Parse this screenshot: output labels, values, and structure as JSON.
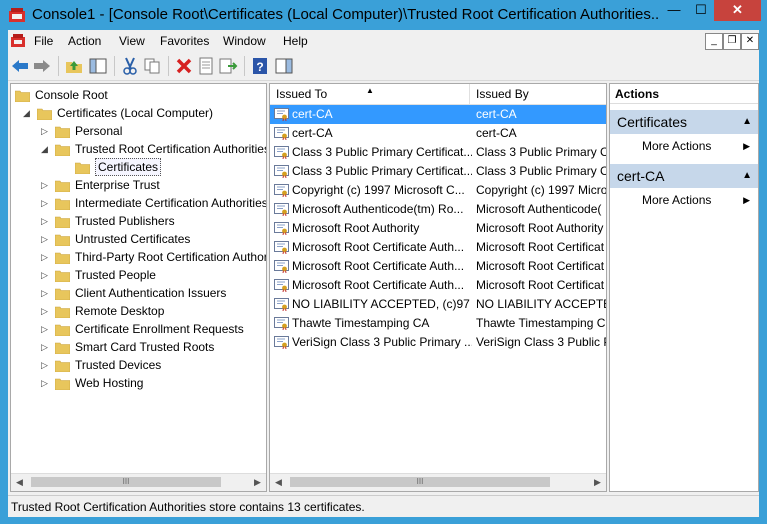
{
  "window": {
    "title": "Console1 - [Console Root\\Certificates (Local Computer)\\Trusted Root Certification Authorities..."
  },
  "titlebar_buttons": {
    "minimize": "—",
    "maximize": "☐",
    "close": "✕"
  },
  "menubar": {
    "items": [
      "File",
      "Action",
      "View",
      "Favorites",
      "Window",
      "Help"
    ],
    "mdi": {
      "minimize": "_",
      "restore": "❐",
      "close": "✕"
    }
  },
  "tree": {
    "items": [
      {
        "label": "Console Root",
        "level": 0,
        "expander": ""
      },
      {
        "label": "Certificates (Local Computer)",
        "level": 1,
        "expander": "◢"
      },
      {
        "label": "Personal",
        "level": 2,
        "expander": "▷"
      },
      {
        "label": "Trusted Root Certification Authorities",
        "level": 2,
        "expander": "◢"
      },
      {
        "label": "Certificates",
        "level": 3,
        "expander": "",
        "selected": true
      },
      {
        "label": "Enterprise Trust",
        "level": 2,
        "expander": "▷"
      },
      {
        "label": "Intermediate Certification Authorities",
        "level": 2,
        "expander": "▷"
      },
      {
        "label": "Trusted Publishers",
        "level": 2,
        "expander": "▷"
      },
      {
        "label": "Untrusted Certificates",
        "level": 2,
        "expander": "▷"
      },
      {
        "label": "Third-Party Root Certification Authorities",
        "level": 2,
        "expander": "▷"
      },
      {
        "label": "Trusted People",
        "level": 2,
        "expander": "▷"
      },
      {
        "label": "Client Authentication Issuers",
        "level": 2,
        "expander": "▷"
      },
      {
        "label": "Remote Desktop",
        "level": 2,
        "expander": "▷"
      },
      {
        "label": "Certificate Enrollment Requests",
        "level": 2,
        "expander": "▷"
      },
      {
        "label": "Smart Card Trusted Roots",
        "level": 2,
        "expander": "▷"
      },
      {
        "label": "Trusted Devices",
        "level": 2,
        "expander": "▷"
      },
      {
        "label": "Web Hosting",
        "level": 2,
        "expander": "▷"
      }
    ]
  },
  "list": {
    "columns": [
      "Issued To",
      "Issued By"
    ],
    "sort_indicator": "▲",
    "rows": [
      {
        "issued_to": "cert-CA",
        "issued_by": "cert-CA",
        "selected": true
      },
      {
        "issued_to": "cert-CA",
        "issued_by": "cert-CA"
      },
      {
        "issued_to": "Class 3 Public Primary Certificat...",
        "issued_by": "Class 3 Public Primary C"
      },
      {
        "issued_to": "Class 3 Public Primary Certificat...",
        "issued_by": "Class 3 Public Primary C"
      },
      {
        "issued_to": "Copyright (c) 1997 Microsoft C...",
        "issued_by": "Copyright (c) 1997 Micro"
      },
      {
        "issued_to": "Microsoft Authenticode(tm) Ro...",
        "issued_by": "Microsoft Authenticode("
      },
      {
        "issued_to": "Microsoft Root Authority",
        "issued_by": "Microsoft Root Authority"
      },
      {
        "issued_to": "Microsoft Root Certificate Auth...",
        "issued_by": "Microsoft Root Certificat"
      },
      {
        "issued_to": "Microsoft Root Certificate Auth...",
        "issued_by": "Microsoft Root Certificat"
      },
      {
        "issued_to": "Microsoft Root Certificate Auth...",
        "issued_by": "Microsoft Root Certificat"
      },
      {
        "issued_to": "NO LIABILITY ACCEPTED, (c)97 ...",
        "issued_by": "NO LIABILITY ACCEPTED"
      },
      {
        "issued_to": "Thawte Timestamping CA",
        "issued_by": "Thawte Timestamping C"
      },
      {
        "issued_to": "VeriSign Class 3 Public Primary ...",
        "issued_by": "VeriSign Class 3 Public P"
      }
    ]
  },
  "actions": {
    "title": "Actions",
    "sections": [
      {
        "label": "Certificates",
        "items": [
          "More Actions"
        ]
      },
      {
        "label": "cert-CA",
        "items": [
          "More Actions"
        ]
      }
    ]
  },
  "scrollbar": {
    "left_arrow": "◀",
    "right_arrow": "▶",
    "grip": "III"
  },
  "status": {
    "text": "Trusted Root Certification Authorities store contains 13 certificates."
  }
}
